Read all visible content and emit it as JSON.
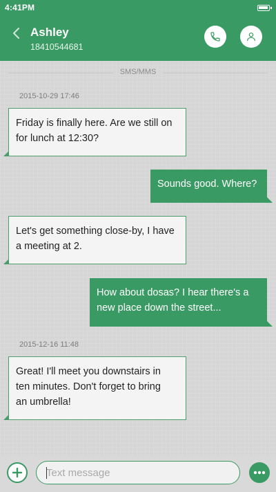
{
  "status_bar": {
    "time": "4:41PM"
  },
  "header": {
    "contact_name": "Ashley",
    "contact_number": "18410544681",
    "back_icon": "chevron-left-icon",
    "call_icon": "phone-icon",
    "contact_icon": "person-icon"
  },
  "conversation": {
    "channel_label": "SMS/MMS",
    "timestamps": [
      "2015-10-29 17:46",
      "2015-12-16 11:48"
    ],
    "messages": [
      {
        "direction": "incoming",
        "lines": [
          "Friday is finally here. Are we still on",
          "for lunch at 12:30?"
        ]
      },
      {
        "direction": "outgoing",
        "lines": [
          "Sounds good. Where?"
        ]
      },
      {
        "direction": "incoming",
        "lines": [
          "Let's get something close-by, I have",
          "a meeting at 2."
        ]
      },
      {
        "direction": "outgoing",
        "lines": [
          "How about dosas? I hear there's a",
          "new place down the street..."
        ]
      },
      {
        "direction": "incoming",
        "lines": [
          "Great! I'll meet you downstairs in",
          "ten minutes. Don't forget to bring",
          "an umbrella!"
        ]
      }
    ]
  },
  "input": {
    "placeholder": "Text message",
    "value": "",
    "add_icon": "plus-icon",
    "more_icon": "more-dots-icon"
  },
  "colors": {
    "accent": "#3a9a63",
    "incoming_bubble": "#f4f4f4",
    "background": "#d6d6d6"
  }
}
